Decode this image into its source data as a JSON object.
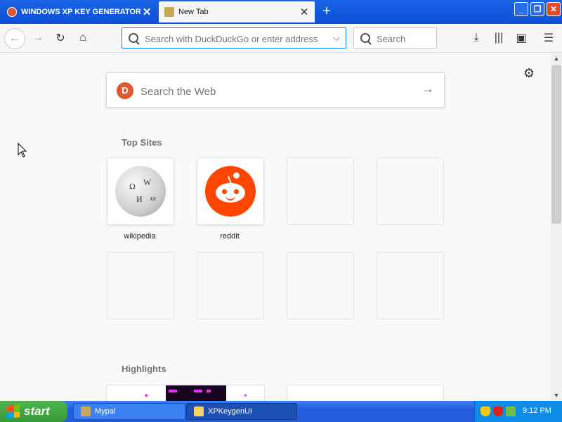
{
  "browser": {
    "tabs": [
      {
        "label": "WINDOWS XP KEY GENERATOR at",
        "active": false
      },
      {
        "label": "New Tab",
        "active": true
      }
    ],
    "window_controls": {
      "minimize": "_",
      "maximize": "❐",
      "close": "✕"
    },
    "url_placeholder": "Search with DuckDuckGo or enter address",
    "search_placeholder": "Search"
  },
  "newtab": {
    "search_placeholder": "Search the Web",
    "top_sites_title": "Top Sites",
    "top_sites": [
      {
        "label": "wikipedia",
        "icon": "wikipedia-globe-icon"
      },
      {
        "label": "reddit",
        "icon": "reddit-alien-icon"
      },
      {
        "label": "",
        "icon": ""
      },
      {
        "label": "",
        "icon": ""
      },
      {
        "label": "",
        "icon": ""
      },
      {
        "label": "",
        "icon": ""
      },
      {
        "label": "",
        "icon": ""
      },
      {
        "label": "",
        "icon": ""
      }
    ],
    "highlights_title": "Highlights"
  },
  "taskbar": {
    "start_label": "start",
    "items": [
      {
        "label": "Mypal",
        "active": true
      },
      {
        "label": "XPKeygenUI",
        "active": false
      }
    ],
    "clock": "9:12 PM"
  },
  "colors": {
    "xp_blue": "#0b4fd6",
    "focus_blue": "#0a84ff",
    "ddg_orange": "#de5833",
    "reddit_orange": "#ff4500",
    "start_green": "#379837"
  }
}
